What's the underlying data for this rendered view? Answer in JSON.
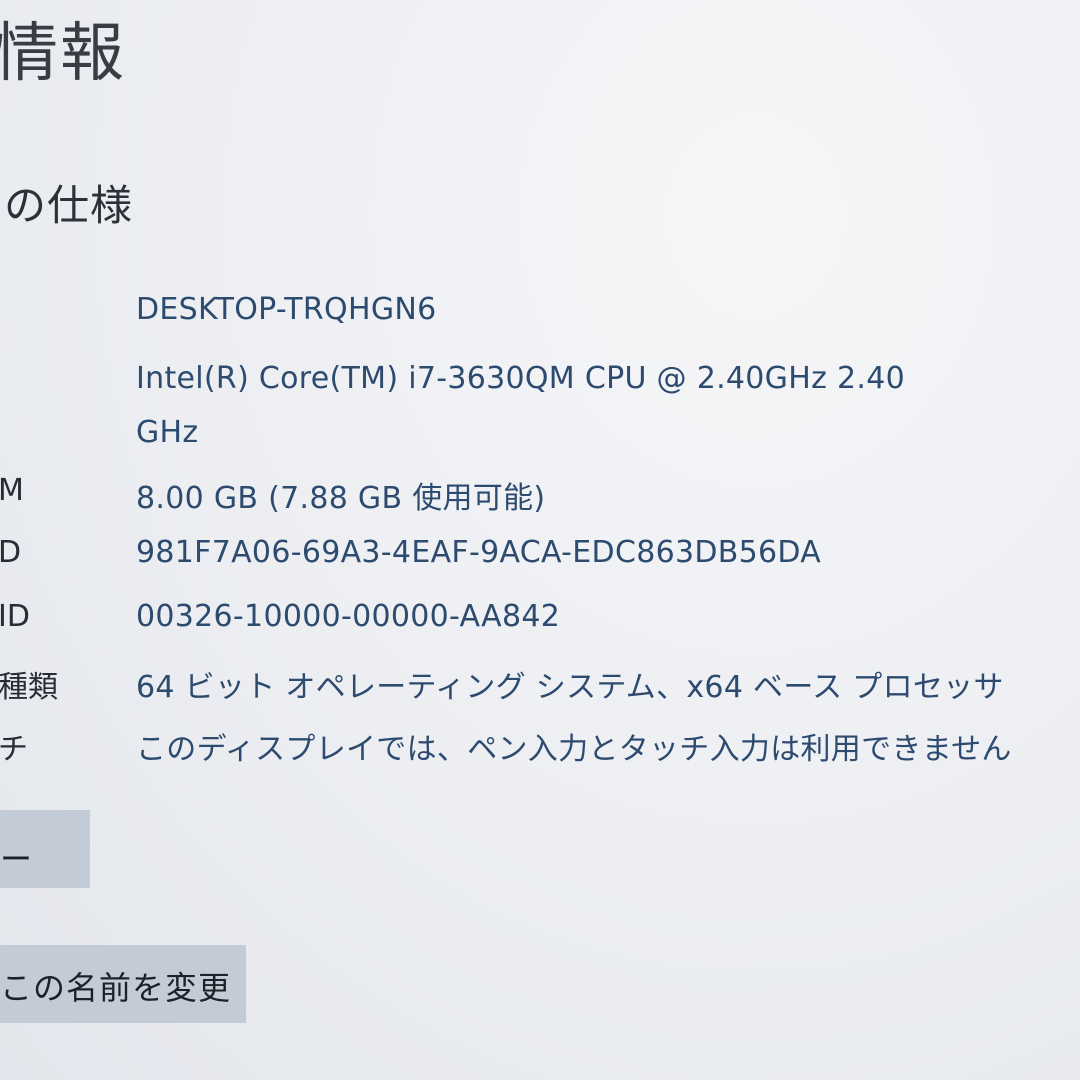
{
  "header": {
    "title": "情報"
  },
  "specs": {
    "section_title": "の仕様",
    "rows": [
      {
        "label": "",
        "value": "DESKTOP-TRQHGN6"
      },
      {
        "label": "",
        "value": "Intel(R) Core(TM) i7-3630QM CPU @ 2.40GHz   2.40 GHz"
      },
      {
        "label": "M",
        "value": "8.00 GB (7.88 GB 使用可能)"
      },
      {
        "label": "D",
        "value": "981F7A06-69A3-4EAF-9ACA-EDC863DB56DA"
      },
      {
        "label": "ID",
        "value": "00326-10000-00000-AA842"
      },
      {
        "label": "種類",
        "value": "64 ビット オペレーティング システム、x64 ベース プロセッサ"
      },
      {
        "label": "チ",
        "value": "このディスプレイでは、ペン入力とタッチ入力は利用できません"
      }
    ]
  },
  "buttons": {
    "upper_label": "ー",
    "rename_label": "この名前を変更"
  }
}
